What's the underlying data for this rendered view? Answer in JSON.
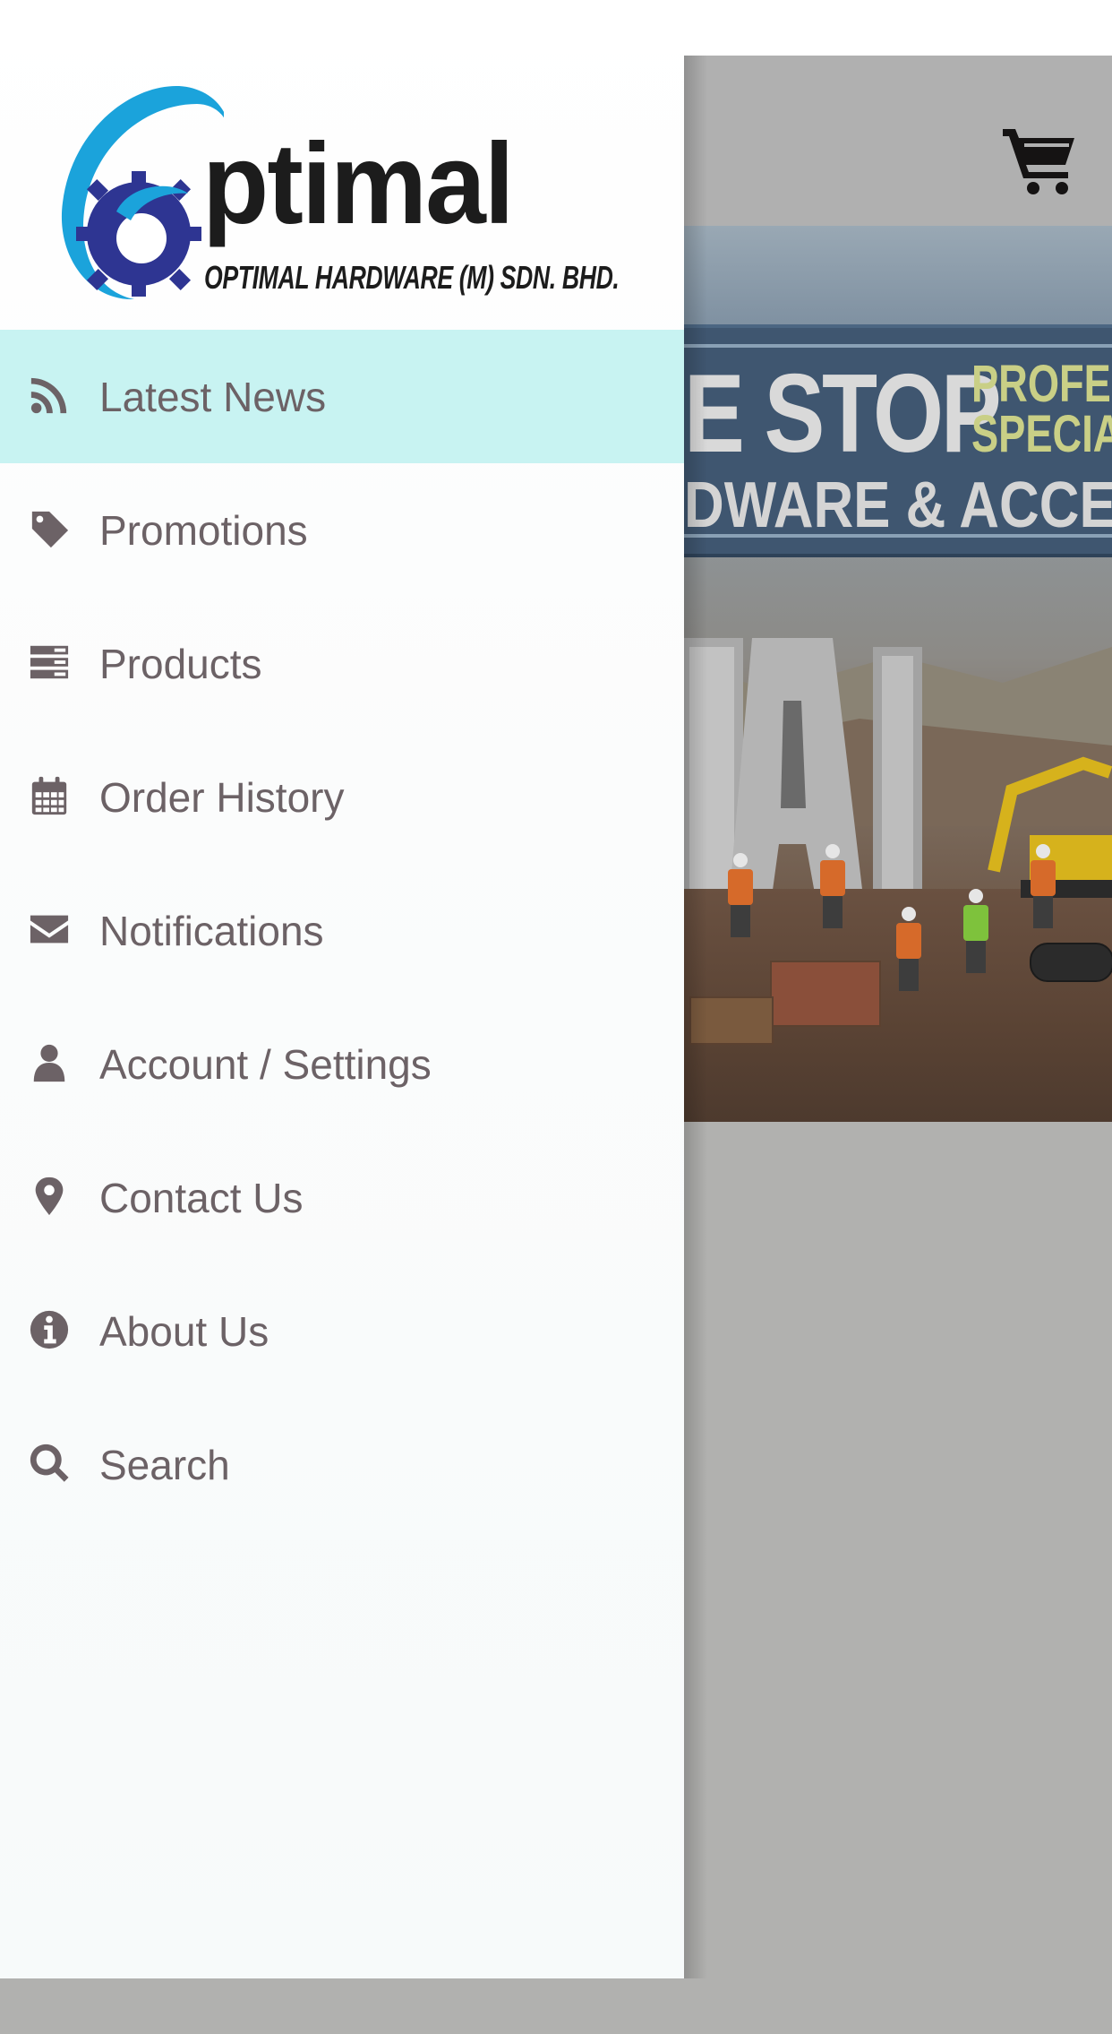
{
  "brand": {
    "wordmark": "ptimal",
    "company": "OPTIMAL HARDWARE (M) SDN. BHD.",
    "colors": {
      "logo_blue_light": "#1ba3db",
      "logo_blue_dark": "#2e3592",
      "text": "#1c1c1c"
    }
  },
  "header": {
    "cart_icon": "shopping-cart-icon"
  },
  "banner": {
    "line1": "E STOP",
    "line2a": "PROFESS",
    "line2b": "SPECIA",
    "line3": "DWARE & ACCESSO"
  },
  "menu": {
    "active_color": "#c8f3f2",
    "text_color": "#6c6266",
    "items": [
      {
        "label": "Latest News",
        "icon": "rss-icon",
        "active": true
      },
      {
        "label": "Promotions",
        "icon": "tag-icon",
        "active": false
      },
      {
        "label": "Products",
        "icon": "list-icon",
        "active": false
      },
      {
        "label": "Order History",
        "icon": "calendar-icon",
        "active": false
      },
      {
        "label": "Notifications",
        "icon": "envelope-icon",
        "active": false
      },
      {
        "label": "Account / Settings",
        "icon": "user-icon",
        "active": false
      },
      {
        "label": "Contact Us",
        "icon": "map-marker-icon",
        "active": false
      },
      {
        "label": "About Us",
        "icon": "info-icon",
        "active": false
      },
      {
        "label": "Search",
        "icon": "search-icon",
        "active": false
      }
    ]
  }
}
